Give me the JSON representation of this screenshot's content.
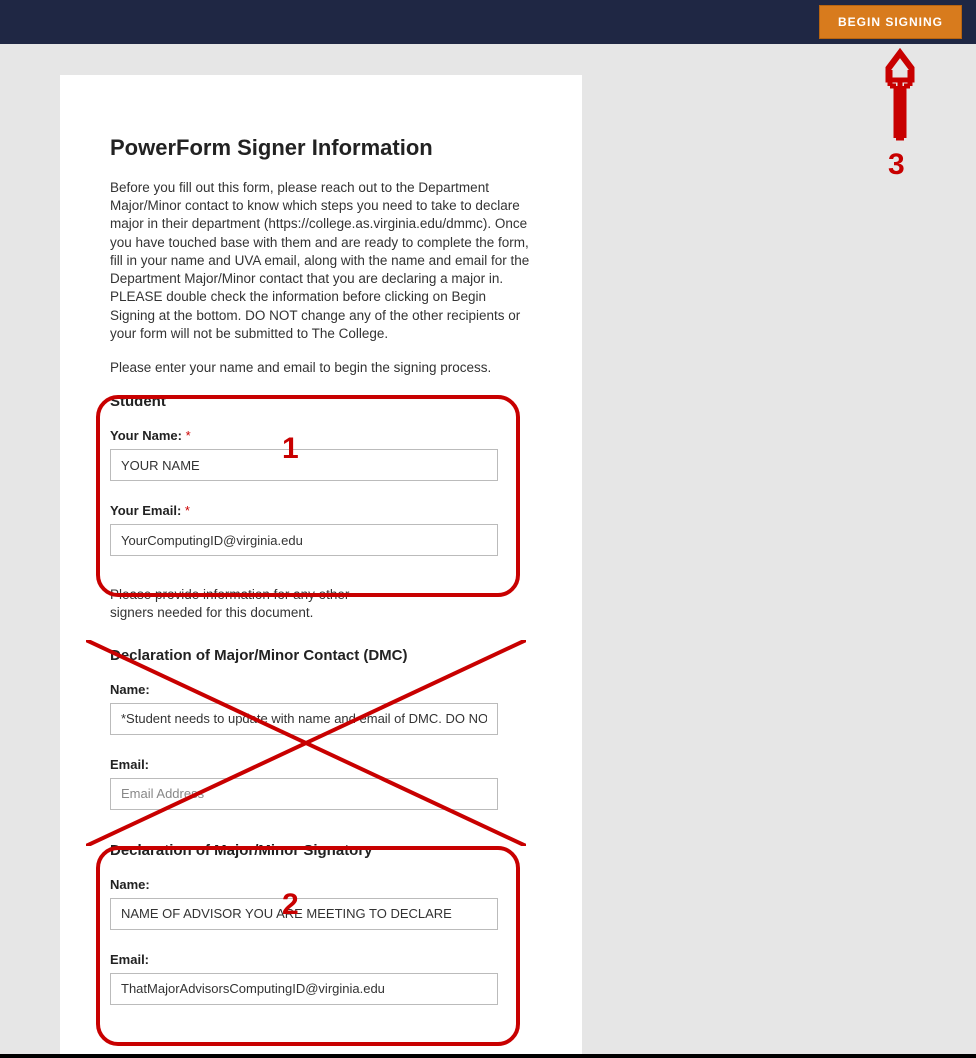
{
  "topbar": {
    "begin_signing_label": "BEGIN SIGNING"
  },
  "page_title": "PowerForm Signer Information",
  "intro_paragraph": "Before you fill out this form, please reach out to the Department Major/Minor contact to know which steps you need to take to declare major in their department (https://college.as.virginia.edu/dmmc). Once you have touched base with them and are ready to complete the form, fill in your name and UVA email, along with the name and email for the Department Major/Minor contact that you are declaring a major in. PLEASE double check the information before clicking on Begin Signing at the bottom. DO NOT change any of the other recipients or your form will not be submitted to The College.",
  "intro_line2": "Please enter your name and email to begin the signing process.",
  "student_section": {
    "heading": "Student",
    "name_label": "Your Name: ",
    "name_value": "YOUR NAME",
    "email_label": "Your Email: ",
    "email_value": "YourComputingID@virginia.edu",
    "required_marker": "*"
  },
  "secondary_note_line1": "Please provide information for any other",
  "secondary_note_line2": "signers needed for this document.",
  "dmc_section": {
    "heading": "Declaration of Major/Minor Contact (DMC)",
    "name_label": "Name:",
    "name_value": "*Student needs to update with name and email of DMC. DO NO",
    "email_label": "Email:",
    "email_placeholder": "Email Address"
  },
  "signatory_section": {
    "heading": "Declaration of Major/Minor Signatory",
    "name_label": "Name:",
    "name_value": "NAME OF ADVISOR YOU ARE MEETING TO DECLARE",
    "email_label": "Email:",
    "email_value": "ThatMajorAdvisorsComputingID@virginia.edu"
  },
  "annotations": {
    "num1": "1",
    "num2": "2",
    "num3": "3"
  },
  "colors": {
    "topbar_bg": "#1f2744",
    "button_bg": "#d87b1d",
    "annotation_red": "#c80000"
  }
}
